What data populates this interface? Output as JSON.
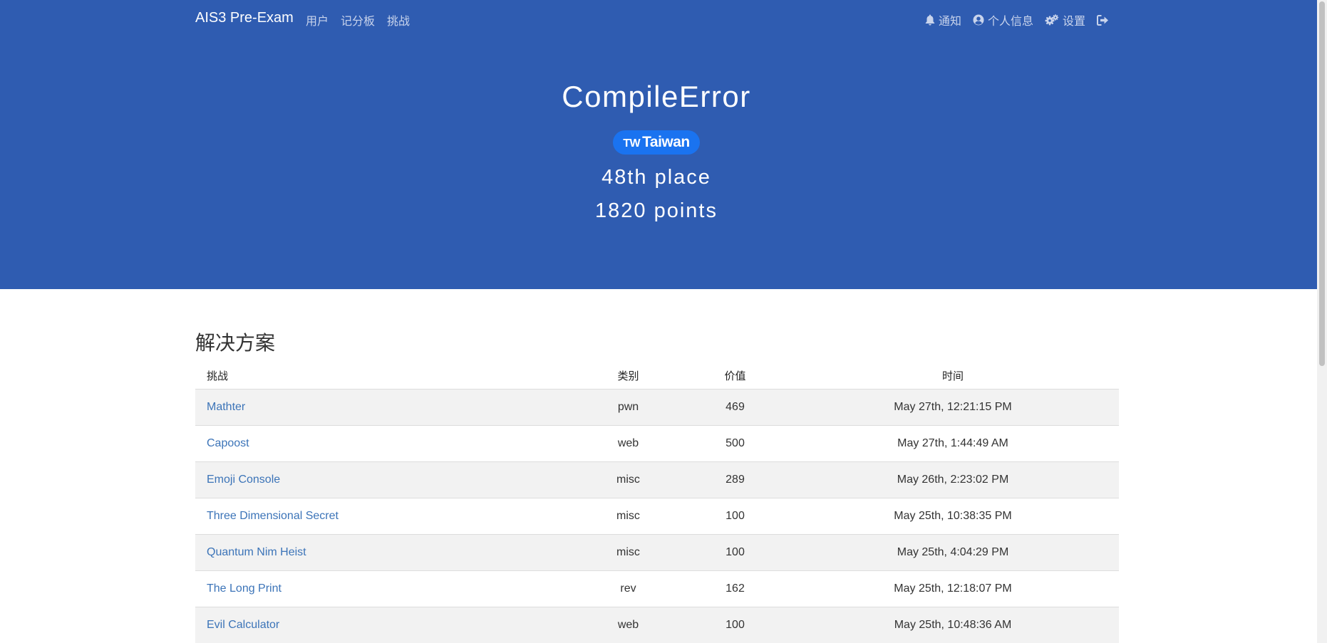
{
  "navbar": {
    "brand": "AIS3 Pre-Exam",
    "links": [
      "用户",
      "记分板",
      "挑战"
    ],
    "notifications_label": "通知",
    "profile_label": "个人信息",
    "settings_label": "设置"
  },
  "team": {
    "name": "CompileError",
    "country_code": "TW",
    "country": "Taiwan",
    "place": "48th place",
    "points": "1820 points"
  },
  "solves": {
    "title": "解决方案",
    "headers": [
      "挑战",
      "类别",
      "价值",
      "时间"
    ],
    "rows": [
      {
        "challenge": "Mathter",
        "category": "pwn",
        "value": "469",
        "time": "May 27th, 12:21:15 PM"
      },
      {
        "challenge": "Capoost",
        "category": "web",
        "value": "500",
        "time": "May 27th, 1:44:49 AM"
      },
      {
        "challenge": "Emoji Console",
        "category": "misc",
        "value": "289",
        "time": "May 26th, 2:23:02 PM"
      },
      {
        "challenge": "Three Dimensional Secret",
        "category": "misc",
        "value": "100",
        "time": "May 25th, 10:38:35 PM"
      },
      {
        "challenge": "Quantum Nim Heist",
        "category": "misc",
        "value": "100",
        "time": "May 25th, 4:04:29 PM"
      },
      {
        "challenge": "The Long Print",
        "category": "rev",
        "value": "162",
        "time": "May 25th, 12:18:07 PM"
      },
      {
        "challenge": "Evil Calculator",
        "category": "web",
        "value": "100",
        "time": "May 25th, 10:48:36 AM"
      }
    ]
  },
  "colors": {
    "hero_bg": "#2f5cb1",
    "badge_bg": "#1a73f0",
    "link": "#3c74b8",
    "stripe": "#f2f2f2"
  },
  "icons": [
    "bell-icon",
    "user-circle-icon",
    "cogs-icon",
    "sign-out-icon"
  ]
}
